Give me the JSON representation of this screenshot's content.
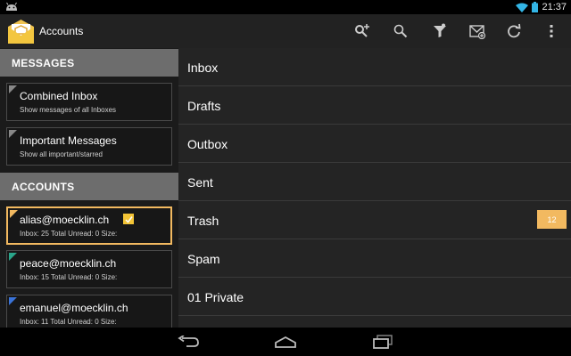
{
  "status_bar": {
    "time": "21:37",
    "notification_icon": "android-debug-icon",
    "wifi_icon": "wifi-icon",
    "battery_icon": "battery-icon"
  },
  "action_bar": {
    "title": "Accounts",
    "app_icon": "envelope-app-icon",
    "actions": [
      "add-account-icon",
      "search-icon",
      "filter-icon",
      "compose-icon",
      "refresh-icon",
      "overflow-menu-icon"
    ]
  },
  "left_pane": {
    "messages_header": "MESSAGES",
    "special_folders": [
      {
        "title": "Combined Inbox",
        "subtitle": "Show messages of all Inboxes"
      },
      {
        "title": "Important Messages",
        "subtitle": "Show all important/starred"
      }
    ],
    "accounts_header": "ACCOUNTS",
    "accounts": [
      {
        "email": "alias@moecklin.ch",
        "stats": "Inbox: 25  Total Unread: 0  Size:",
        "color": "#f2b960",
        "selected": true
      },
      {
        "email": "peace@moecklin.ch",
        "stats": "Inbox: 15  Total Unread: 0  Size:",
        "color": "#2aa58a",
        "selected": false
      },
      {
        "email": "emanuel@moecklin.ch",
        "stats": "Inbox: 11  Total Unread: 0  Size:",
        "color": "#3a73d8",
        "selected": false
      }
    ]
  },
  "folders": [
    {
      "name": "Inbox"
    },
    {
      "name": "Drafts"
    },
    {
      "name": "Outbox"
    },
    {
      "name": "Sent"
    },
    {
      "name": "Trash",
      "count": "12"
    },
    {
      "name": "Spam"
    },
    {
      "name": "01 Private"
    }
  ],
  "nav_bar": [
    "back-icon",
    "home-icon",
    "recent-apps-icon"
  ],
  "colors": {
    "accent": "#f2b960",
    "section_header": "#6d6d6d",
    "folder_bg": "#242424",
    "action_bar": "#222222"
  }
}
